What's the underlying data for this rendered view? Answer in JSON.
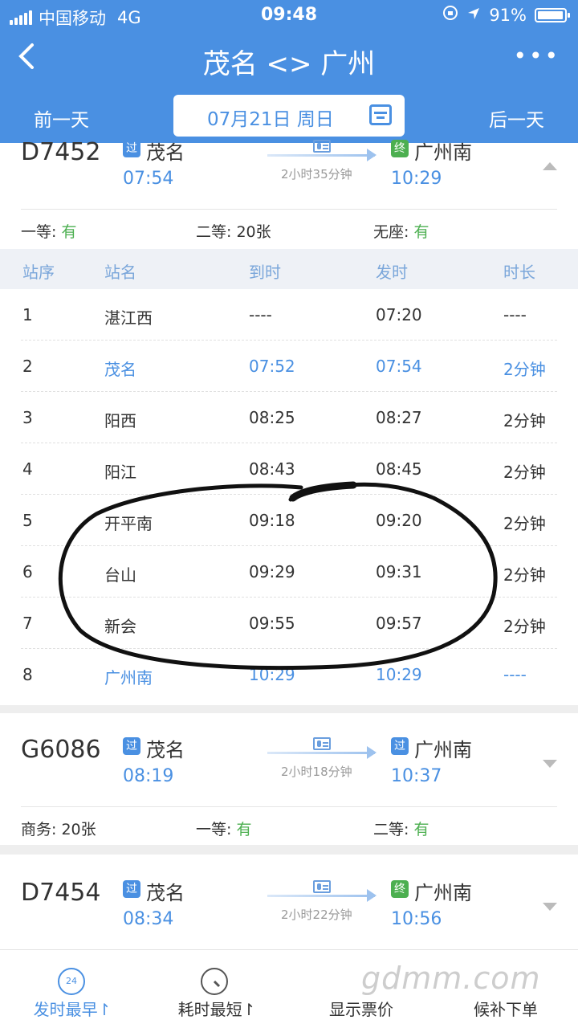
{
  "status_bar": {
    "carrier": "中国移动",
    "network": "4G",
    "time": "09:48",
    "battery": "91%"
  },
  "nav": {
    "title": "茂名 <> 广州",
    "back_label": "〈",
    "more_label": "•••"
  },
  "date_bar": {
    "prev": "前一天",
    "date": "07月21日 周日",
    "next": "后一天"
  },
  "train1": {
    "number": "D7452",
    "from_badge": "过",
    "from": "茂名",
    "depart": "07:54",
    "duration": "2小时35分钟",
    "to_badge": "终",
    "to": "广州南",
    "arrive": "10:29",
    "seats": [
      {
        "label": "一等: ",
        "value": "有"
      },
      {
        "label": "二等: 20张",
        "value": ""
      },
      {
        "label": "无座: ",
        "value": "有"
      }
    ]
  },
  "stops_header": [
    "站序",
    "站名",
    "到时",
    "发时",
    "时长"
  ],
  "stops": [
    [
      "1",
      "湛江西",
      "----",
      "07:20",
      "----"
    ],
    [
      "2",
      "茂名",
      "07:52",
      "07:54",
      "2分钟"
    ],
    [
      "3",
      "阳西",
      "08:25",
      "08:27",
      "2分钟"
    ],
    [
      "4",
      "阳江",
      "08:43",
      "08:45",
      "2分钟"
    ],
    [
      "5",
      "开平南",
      "09:18",
      "09:20",
      "2分钟"
    ],
    [
      "6",
      "台山",
      "09:29",
      "09:31",
      "2分钟"
    ],
    [
      "7",
      "新会",
      "09:55",
      "09:57",
      "2分钟"
    ],
    [
      "8",
      "广州南",
      "10:29",
      "10:29",
      "----"
    ]
  ],
  "train2": {
    "number": "G6086",
    "from_badge": "过",
    "from": "茂名",
    "depart": "08:19",
    "duration": "2小时18分钟",
    "to_badge": "过",
    "to": "广州南",
    "arrive": "10:37",
    "seats": [
      {
        "label": "商务: 20张",
        "value": ""
      },
      {
        "label": "一等: ",
        "value": "有"
      },
      {
        "label": "二等: ",
        "value": "有"
      }
    ]
  },
  "train3": {
    "number": "D7454",
    "from_badge": "过",
    "from": "茂名",
    "depart": "08:34",
    "duration": "2小时22分钟",
    "to_badge": "终",
    "to": "广州南",
    "arrive": "10:56"
  },
  "tabbar": {
    "tab1": {
      "label": "发时最早↾",
      "icon_text": "24"
    },
    "tab2": {
      "label": "耗时最短↾"
    },
    "tab3": {
      "label": "显示票价"
    },
    "tab4": {
      "label": "候补下单"
    }
  },
  "watermark": "gdmm.com",
  "colors": {
    "brand": "#4a90e2",
    "available": "#4caf50",
    "circle_mark": "#111111"
  }
}
